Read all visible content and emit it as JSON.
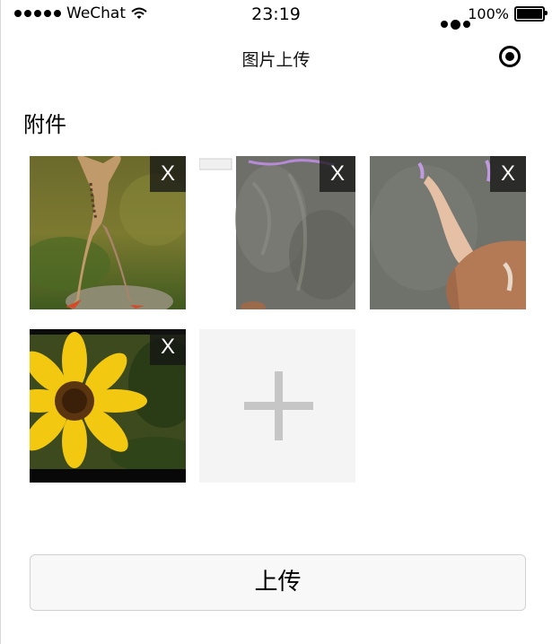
{
  "status_bar": {
    "carrier": "WeChat",
    "time": "23:19",
    "battery_percent": "100%"
  },
  "nav": {
    "title": "图片上传",
    "more_icon": "more-dots-icon",
    "target_icon": "record-target-icon"
  },
  "section": {
    "title": "附件"
  },
  "attachments": [
    {
      "image": "frog-photo",
      "delete_label": "X"
    },
    {
      "image": "chalkboard-photo",
      "delete_label": "X"
    },
    {
      "image": "child-drawing-on-chalkboard-photo",
      "delete_label": "X"
    },
    {
      "image": "sunflower-photo",
      "delete_label": "X"
    }
  ],
  "add_tile": {
    "icon": "plus-icon"
  },
  "upload_button": {
    "label": "上传"
  },
  "colors": {
    "delete_overlay": "#141414",
    "add_tile_bg": "#f4f4f4",
    "plus": "#c6c6c6",
    "button_bg": "#f8f8f8",
    "button_border": "#d1d1d1"
  }
}
